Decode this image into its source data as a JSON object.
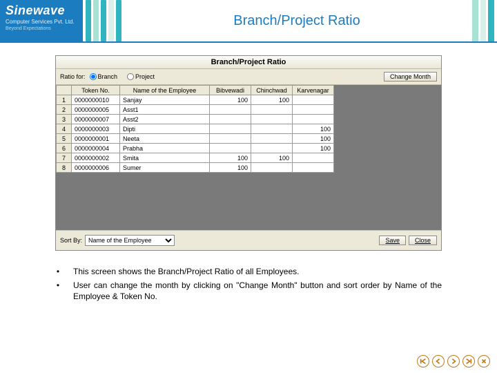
{
  "brand": {
    "name": "Sinewave",
    "line1": "Computer Services Pvt. Ltd.",
    "line2": "Beyond Expectations"
  },
  "header_bars": [
    "#2eb5c0",
    "#a7e2d2",
    "#2eb5c0",
    "#d9f0e8",
    "#2eb5c0"
  ],
  "header_bars_right": [
    "#a7e2d2",
    "#d9f0e8",
    "#2eb5c0"
  ],
  "slide_title": "Branch/Project Ratio",
  "window": {
    "title": "Branch/Project Ratio",
    "ratio_label": "Ratio for:",
    "radio_branch": "Branch",
    "radio_project": "Project",
    "change_month": "Change Month",
    "columns": {
      "rownum": "",
      "token": "Token No.",
      "name": "Name of the Employee",
      "b1": "Bibvewadi",
      "b2": "Chinchwad",
      "b3": "Karvenagar"
    },
    "rows": [
      {
        "n": "1",
        "token": "0000000010",
        "name": "Sanjay",
        "b1": "100",
        "b2": "100",
        "b3": ""
      },
      {
        "n": "2",
        "token": "0000000005",
        "name": "Asst1",
        "b1": "",
        "b2": "",
        "b3": ""
      },
      {
        "n": "3",
        "token": "0000000007",
        "name": "Asst2",
        "b1": "",
        "b2": "",
        "b3": ""
      },
      {
        "n": "4",
        "token": "0000000003",
        "name": "Dipti",
        "b1": "",
        "b2": "",
        "b3": "100"
      },
      {
        "n": "5",
        "token": "0000000001",
        "name": "Neeta",
        "b1": "",
        "b2": "",
        "b3": "100"
      },
      {
        "n": "6",
        "token": "0000000004",
        "name": "Prabha",
        "b1": "",
        "b2": "",
        "b3": "100"
      },
      {
        "n": "7",
        "token": "0000000002",
        "name": "Smita",
        "b1": "100",
        "b2": "100",
        "b3": ""
      },
      {
        "n": "8",
        "token": "0000000006",
        "name": "Sumer",
        "b1": "100",
        "b2": "",
        "b3": ""
      }
    ],
    "sort_label": "Sort By:",
    "sort_value": "Name of the Employee",
    "save": "Save",
    "close": "Close"
  },
  "bullets": [
    "This screen shows the Branch/Project Ratio of all Employees.",
    "User can change the month by clicking on \"Change Month\" button and sort order by Name of the Employee & Token No."
  ]
}
